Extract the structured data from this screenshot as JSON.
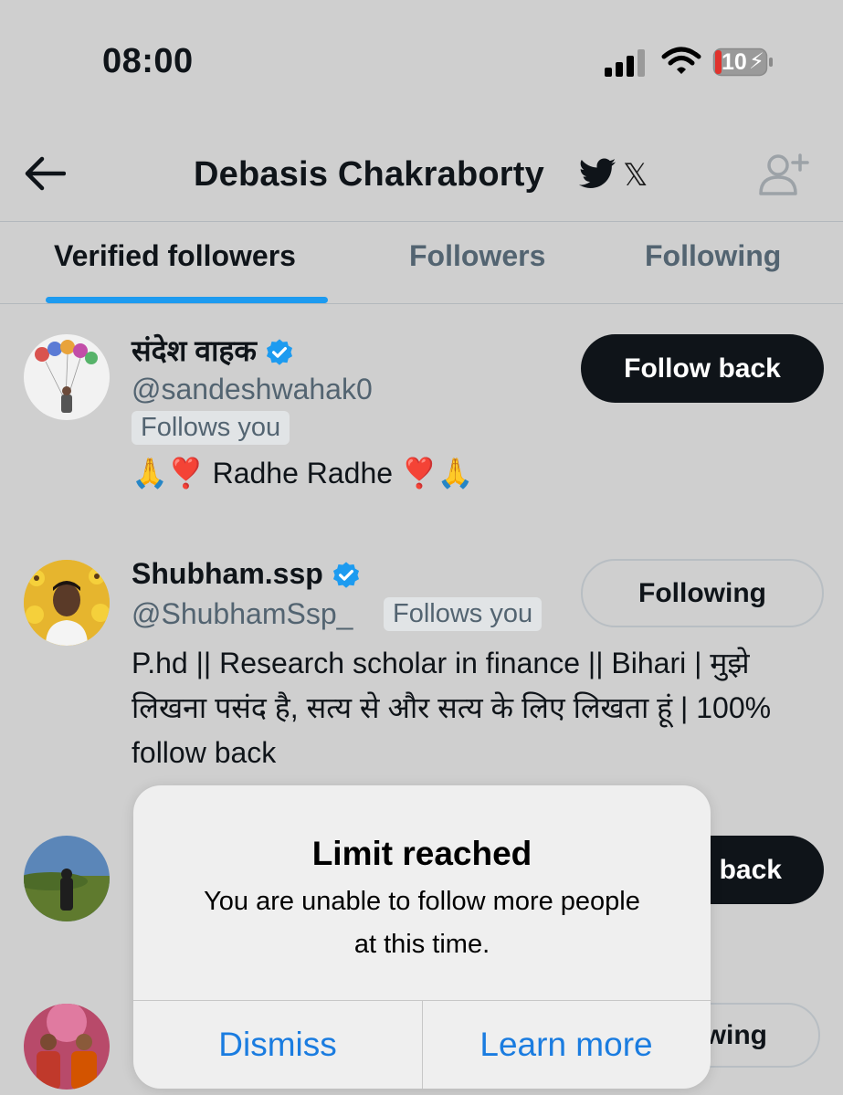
{
  "status_bar": {
    "time": "08:00",
    "battery_level": "10"
  },
  "header": {
    "title": "Debasis Chakraborty",
    "x_glyph": "𝕏"
  },
  "tabs": [
    {
      "label": "Verified followers",
      "active": true
    },
    {
      "label": "Followers",
      "active": false
    },
    {
      "label": "Following",
      "active": false
    }
  ],
  "users": [
    {
      "name": "संदेश वाहक",
      "handle": "@sandeshwahak0",
      "follows_you": "Follows you",
      "bio": "🙏❣️ Radhe Radhe ❣️🙏",
      "button": "Follow back"
    },
    {
      "name": "Shubham.ssp",
      "handle": "@ShubhamSsp_",
      "follows_you": "Follows you",
      "bio_lines": [
        "P.hd || Research scholar in finance || Bihari | मुझे",
        "लिखना पसंद है, सत्य से और सत्य के लिए लिखता हूं | 100%",
        "follow back"
      ],
      "button": "Following"
    },
    {
      "button": "back"
    },
    {
      "button": "wing"
    }
  ],
  "alert": {
    "title": "Limit reached",
    "message_lines": [
      "You are unable to follow more people",
      "at this time."
    ],
    "dismiss": "Dismiss",
    "learn_more": "Learn more"
  },
  "colors": {
    "accent": "#1d9bf0",
    "button_dark": "#0f1419",
    "link": "#1a7ce0"
  }
}
